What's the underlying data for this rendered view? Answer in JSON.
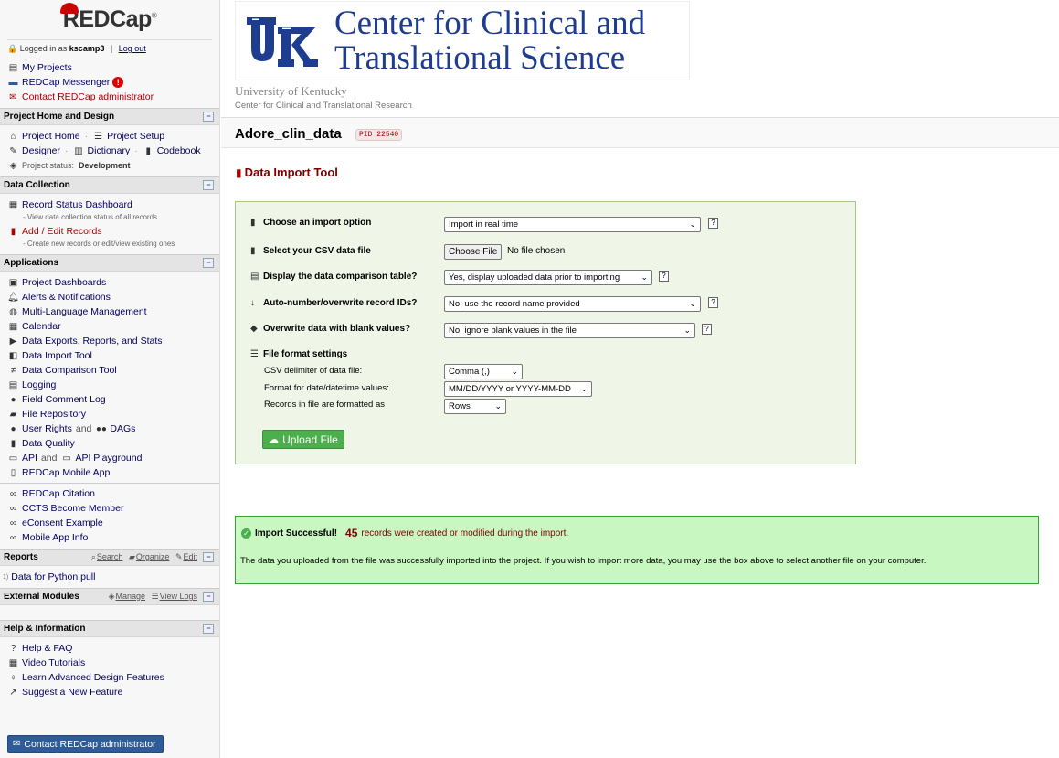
{
  "brand": {
    "logo_text": "REDCap",
    "logo_reg": "®"
  },
  "user": {
    "prefix": "Logged in as",
    "username": "kscamp3",
    "separator": "|",
    "logout": "Log out"
  },
  "top_links": [
    {
      "label": "My Projects"
    },
    {
      "label": "REDCap Messenger"
    },
    {
      "label": "Contact REDCap administrator"
    }
  ],
  "messenger_badge": "!",
  "sections": {
    "project_home": "Project Home and Design",
    "data_collection": "Data Collection",
    "applications": "Applications",
    "reports": "Reports",
    "external_modules": "External Modules",
    "help": "Help & Information"
  },
  "collapse_symbol": "−",
  "project_home": {
    "home": "Project Home",
    "setup": "Project Setup",
    "designer": "Designer",
    "dictionary": "Dictionary",
    "codebook": "Codebook",
    "status_label": "Project status:",
    "status_value": "Development",
    "sep": "·"
  },
  "data_collection": {
    "dashboard": "Record Status Dashboard",
    "dashboard_sub": "- View data collection status of all records",
    "add_edit": "Add / Edit Records",
    "add_edit_sub": "- Create new records or edit/view existing ones"
  },
  "applications": {
    "items": [
      "Project Dashboards",
      "Alerts & Notifications",
      "Multi-Language Management",
      "Calendar",
      "Data Exports, Reports, and Stats",
      "Data Import Tool",
      "Data Comparison Tool",
      "Logging",
      "Field Comment Log",
      "File Repository"
    ],
    "user_rights": "User Rights",
    "and": "and",
    "dags": "DAGs",
    "data_quality": "Data Quality",
    "api": "API",
    "api_playground": "API Playground",
    "mobile_app": "REDCap Mobile App"
  },
  "extra_links": [
    "REDCap Citation",
    "CCTS Become Member",
    "eConsent Example",
    "Mobile App Info"
  ],
  "reports": {
    "search": "Search",
    "organize": "Organize",
    "edit": "Edit",
    "item_num": "1)",
    "item": "Data for Python pull"
  },
  "external_modules": {
    "manage": "Manage",
    "view_logs": "View Logs"
  },
  "help": {
    "items": [
      "Help & FAQ",
      "Video Tutorials",
      "Learn Advanced Design Features",
      "Suggest a New Feature"
    ]
  },
  "contact_button": "Contact REDCap administrator",
  "header": {
    "banner_line1": "Center for Clinical and",
    "banner_line2": "Translational Science",
    "institution": "University of Kentucky",
    "center": "Center for Clinical and Translational Research"
  },
  "project": {
    "title": "Adore_clin_data",
    "pid": "PID 22540"
  },
  "page": {
    "title": "Data Import Tool"
  },
  "import_form": {
    "import_option_label": "Choose an import option",
    "import_option_value": "Import in real time",
    "csv_label": "Select your CSV data file",
    "choose_file": "Choose File",
    "no_file": "No file chosen",
    "comparison_label": "Display the data comparison table?",
    "comparison_value": "Yes, display uploaded data prior to importing",
    "autonumber_label": "Auto-number/overwrite record IDs?",
    "autonumber_value": "No, use the record name provided",
    "overwrite_label": "Overwrite data with blank values?",
    "overwrite_value": "No, ignore blank values in the file",
    "format_header": "File format settings",
    "delimiter_label": "CSV delimiter of data file:",
    "delimiter_value": "Comma (,)",
    "date_label": "Format for date/datetime values:",
    "date_value": "MM/DD/YYYY or YYYY-MM-DD",
    "records_label": "Records in file are formatted as",
    "records_value": "Rows",
    "help": "?",
    "upload": "Upload File"
  },
  "success": {
    "title": "Import Successful!",
    "count": "45",
    "message": "records were created or modified during the import.",
    "body": "The data you uploaded from the file was successfully imported into the project. If you wish to import more data, you may use the box above to select another file on your computer."
  },
  "colors": {
    "accent_red": "#800000",
    "link": "#000066",
    "success_bg": "#c9f7c1",
    "form_bg": "#eff6e8",
    "uk_blue": "#1e3d8f"
  }
}
